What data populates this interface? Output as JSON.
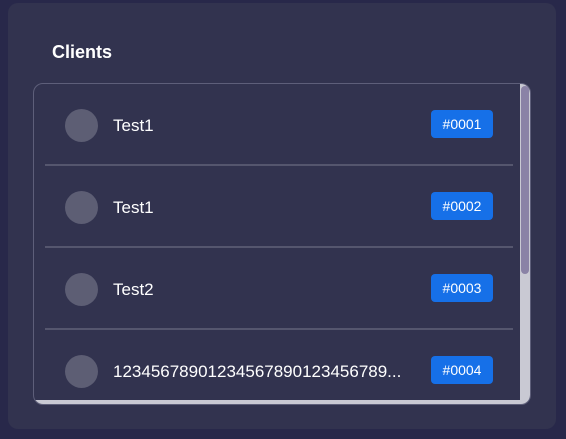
{
  "card": {
    "title": "Clients"
  },
  "clients": [
    {
      "name": "Test1",
      "id": "#0001"
    },
    {
      "name": "Test1",
      "id": "#0002"
    },
    {
      "name": "Test2",
      "id": "#0003"
    },
    {
      "name": "12345678901234567890123456789...",
      "id": "#0004"
    }
  ],
  "colors": {
    "badge": "#1670e8",
    "card": "#32334f",
    "background": "#28284a"
  }
}
